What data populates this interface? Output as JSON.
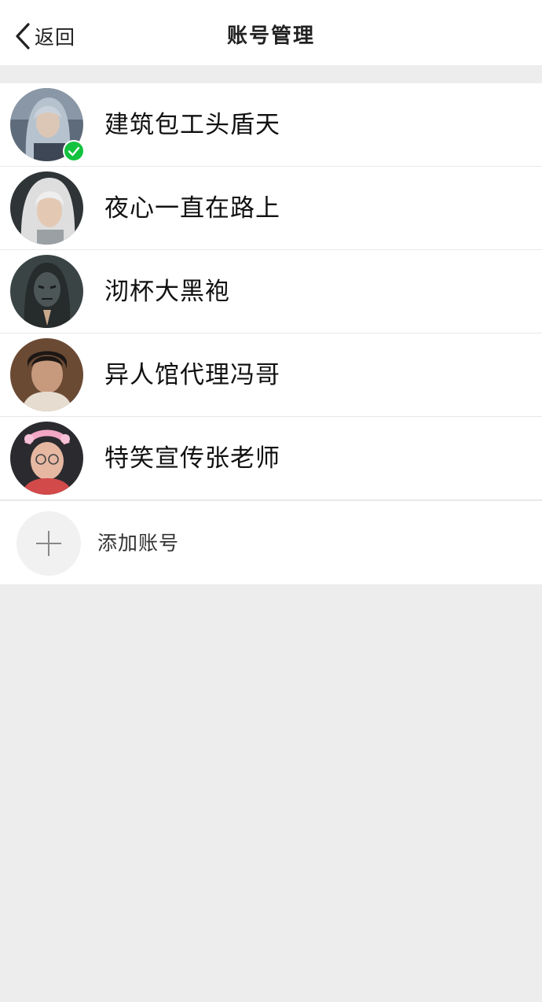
{
  "nav": {
    "back_label": "返回",
    "title": "账号管理"
  },
  "accounts": [
    {
      "name": "建筑包工头盾天",
      "active": true,
      "avatar_icon": "avatar-silver-hair-warrior"
    },
    {
      "name": "夜心一直在路上",
      "active": false,
      "avatar_icon": "avatar-white-hair-person"
    },
    {
      "name": "沏杯大黑袍",
      "active": false,
      "avatar_icon": "avatar-dark-masked-figure"
    },
    {
      "name": "异人馆代理冯哥",
      "active": false,
      "avatar_icon": "avatar-man-portrait"
    },
    {
      "name": "特笑宣传张老师",
      "active": false,
      "avatar_icon": "avatar-man-pink-headband"
    }
  ],
  "add_account": {
    "label": "添加账号"
  },
  "colors": {
    "background": "#ededed",
    "surface": "#ffffff",
    "check": "#12c23e",
    "text": "#111111"
  }
}
